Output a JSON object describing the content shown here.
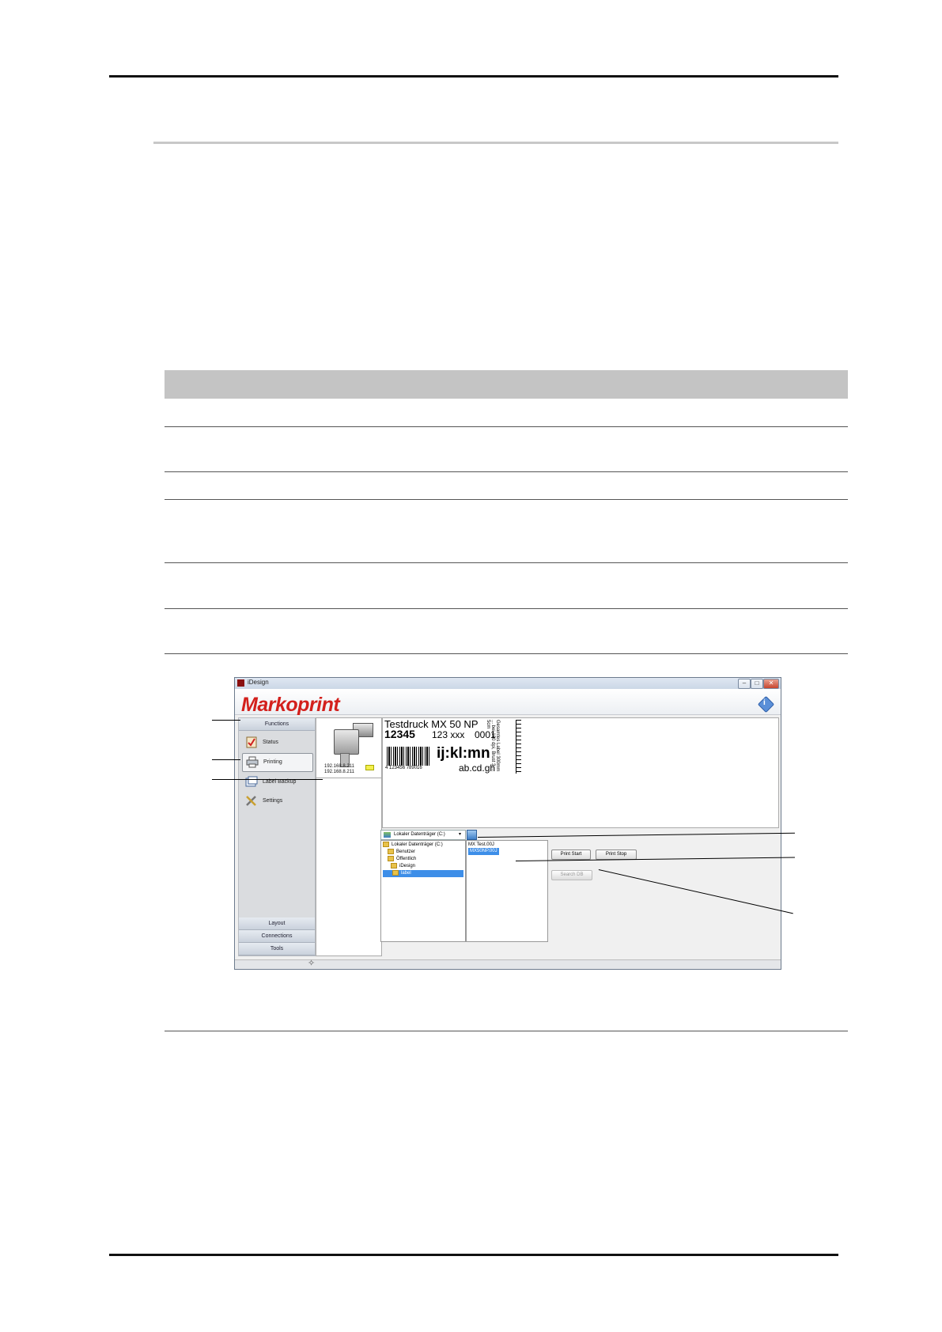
{
  "window": {
    "title": "iDesign",
    "min_label": "–",
    "max_label": "□",
    "close_label": "✕"
  },
  "brand": {
    "logo_text": "Markoprint",
    "info_icon": "info-icon"
  },
  "sidebar": {
    "header": "Functions",
    "items": [
      {
        "label": "Status",
        "icon": "status-icon"
      },
      {
        "label": "Printing",
        "icon": "printer-icon"
      },
      {
        "label": "Label Backup",
        "icon": "backup-icon"
      },
      {
        "label": "Settings",
        "icon": "tools-icon"
      }
    ],
    "bottom_sections": [
      "Layout",
      "Connections",
      "Tools"
    ]
  },
  "device": {
    "ip_1": "192.168.8.211",
    "ip_2": "192.168.8.211"
  },
  "preview": {
    "title": "Testdruck MX 50 NP",
    "num": "12345",
    "code": "123 xxx",
    "counter": "0001",
    "big_text": "ij:kl:mn",
    "sub_text": "ab.cd.gh",
    "barcode_number": "4 123456 789016",
    "vertical_text": "Gesamtes Label 300mm ... bei 180 dpi, Brust 3 ... 5cm"
  },
  "files": {
    "drive_label": "Lokaler Datenträger (C:)",
    "drive_arrow": "▾",
    "tree": [
      {
        "label": "Lokaler Datenträger (C:)",
        "selected": false
      },
      {
        "label": "Benutzer",
        "selected": false
      },
      {
        "label": "Öffentlich",
        "selected": false
      },
      {
        "label": "iDesign",
        "selected": false
      },
      {
        "label": "label",
        "selected": true
      }
    ],
    "list": [
      {
        "label": "MX Test.00J",
        "selected": false
      },
      {
        "label": "MX50NP.00J",
        "selected": true
      }
    ]
  },
  "buttons": {
    "print_start": "Print Start",
    "print_stop": "Print Stop",
    "search_db": "Search DB"
  }
}
